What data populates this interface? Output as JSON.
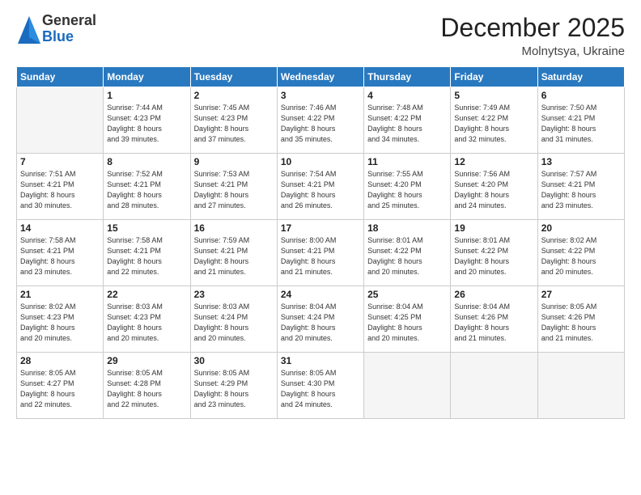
{
  "logo": {
    "general": "General",
    "blue": "Blue"
  },
  "title": "December 2025",
  "location": "Molnytsya, Ukraine",
  "weekdays": [
    "Sunday",
    "Monday",
    "Tuesday",
    "Wednesday",
    "Thursday",
    "Friday",
    "Saturday"
  ],
  "weeks": [
    [
      {
        "day": "",
        "info": ""
      },
      {
        "day": "1",
        "info": "Sunrise: 7:44 AM\nSunset: 4:23 PM\nDaylight: 8 hours\nand 39 minutes."
      },
      {
        "day": "2",
        "info": "Sunrise: 7:45 AM\nSunset: 4:23 PM\nDaylight: 8 hours\nand 37 minutes."
      },
      {
        "day": "3",
        "info": "Sunrise: 7:46 AM\nSunset: 4:22 PM\nDaylight: 8 hours\nand 35 minutes."
      },
      {
        "day": "4",
        "info": "Sunrise: 7:48 AM\nSunset: 4:22 PM\nDaylight: 8 hours\nand 34 minutes."
      },
      {
        "day": "5",
        "info": "Sunrise: 7:49 AM\nSunset: 4:22 PM\nDaylight: 8 hours\nand 32 minutes."
      },
      {
        "day": "6",
        "info": "Sunrise: 7:50 AM\nSunset: 4:21 PM\nDaylight: 8 hours\nand 31 minutes."
      }
    ],
    [
      {
        "day": "7",
        "info": "Sunrise: 7:51 AM\nSunset: 4:21 PM\nDaylight: 8 hours\nand 30 minutes."
      },
      {
        "day": "8",
        "info": "Sunrise: 7:52 AM\nSunset: 4:21 PM\nDaylight: 8 hours\nand 28 minutes."
      },
      {
        "day": "9",
        "info": "Sunrise: 7:53 AM\nSunset: 4:21 PM\nDaylight: 8 hours\nand 27 minutes."
      },
      {
        "day": "10",
        "info": "Sunrise: 7:54 AM\nSunset: 4:21 PM\nDaylight: 8 hours\nand 26 minutes."
      },
      {
        "day": "11",
        "info": "Sunrise: 7:55 AM\nSunset: 4:20 PM\nDaylight: 8 hours\nand 25 minutes."
      },
      {
        "day": "12",
        "info": "Sunrise: 7:56 AM\nSunset: 4:20 PM\nDaylight: 8 hours\nand 24 minutes."
      },
      {
        "day": "13",
        "info": "Sunrise: 7:57 AM\nSunset: 4:21 PM\nDaylight: 8 hours\nand 23 minutes."
      }
    ],
    [
      {
        "day": "14",
        "info": "Sunrise: 7:58 AM\nSunset: 4:21 PM\nDaylight: 8 hours\nand 23 minutes."
      },
      {
        "day": "15",
        "info": "Sunrise: 7:58 AM\nSunset: 4:21 PM\nDaylight: 8 hours\nand 22 minutes."
      },
      {
        "day": "16",
        "info": "Sunrise: 7:59 AM\nSunset: 4:21 PM\nDaylight: 8 hours\nand 21 minutes."
      },
      {
        "day": "17",
        "info": "Sunrise: 8:00 AM\nSunset: 4:21 PM\nDaylight: 8 hours\nand 21 minutes."
      },
      {
        "day": "18",
        "info": "Sunrise: 8:01 AM\nSunset: 4:22 PM\nDaylight: 8 hours\nand 20 minutes."
      },
      {
        "day": "19",
        "info": "Sunrise: 8:01 AM\nSunset: 4:22 PM\nDaylight: 8 hours\nand 20 minutes."
      },
      {
        "day": "20",
        "info": "Sunrise: 8:02 AM\nSunset: 4:22 PM\nDaylight: 8 hours\nand 20 minutes."
      }
    ],
    [
      {
        "day": "21",
        "info": "Sunrise: 8:02 AM\nSunset: 4:23 PM\nDaylight: 8 hours\nand 20 minutes."
      },
      {
        "day": "22",
        "info": "Sunrise: 8:03 AM\nSunset: 4:23 PM\nDaylight: 8 hours\nand 20 minutes."
      },
      {
        "day": "23",
        "info": "Sunrise: 8:03 AM\nSunset: 4:24 PM\nDaylight: 8 hours\nand 20 minutes."
      },
      {
        "day": "24",
        "info": "Sunrise: 8:04 AM\nSunset: 4:24 PM\nDaylight: 8 hours\nand 20 minutes."
      },
      {
        "day": "25",
        "info": "Sunrise: 8:04 AM\nSunset: 4:25 PM\nDaylight: 8 hours\nand 20 minutes."
      },
      {
        "day": "26",
        "info": "Sunrise: 8:04 AM\nSunset: 4:26 PM\nDaylight: 8 hours\nand 21 minutes."
      },
      {
        "day": "27",
        "info": "Sunrise: 8:05 AM\nSunset: 4:26 PM\nDaylight: 8 hours\nand 21 minutes."
      }
    ],
    [
      {
        "day": "28",
        "info": "Sunrise: 8:05 AM\nSunset: 4:27 PM\nDaylight: 8 hours\nand 22 minutes."
      },
      {
        "day": "29",
        "info": "Sunrise: 8:05 AM\nSunset: 4:28 PM\nDaylight: 8 hours\nand 22 minutes."
      },
      {
        "day": "30",
        "info": "Sunrise: 8:05 AM\nSunset: 4:29 PM\nDaylight: 8 hours\nand 23 minutes."
      },
      {
        "day": "31",
        "info": "Sunrise: 8:05 AM\nSunset: 4:30 PM\nDaylight: 8 hours\nand 24 minutes."
      },
      {
        "day": "",
        "info": ""
      },
      {
        "day": "",
        "info": ""
      },
      {
        "day": "",
        "info": ""
      }
    ]
  ]
}
